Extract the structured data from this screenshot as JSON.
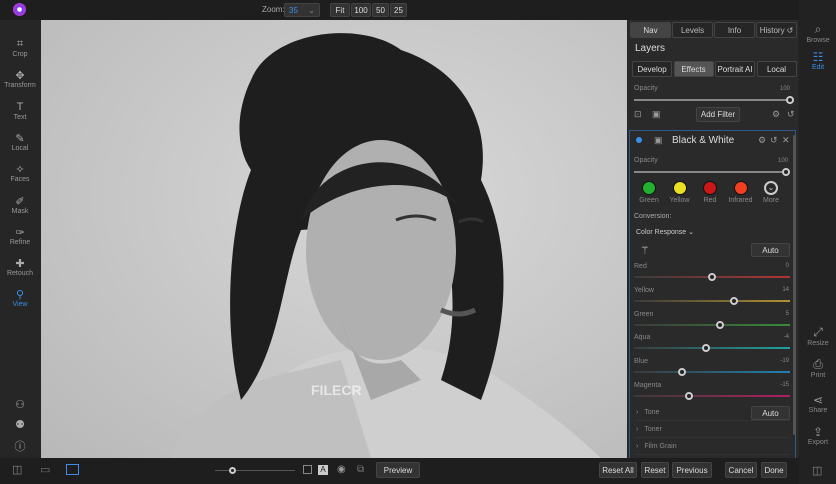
{
  "topbar": {
    "zoom_label": "Zoom:",
    "zoom_value": "35",
    "zoom_presets": [
      "Fit",
      "100",
      "50",
      "25"
    ]
  },
  "tools": [
    {
      "label": "Crop",
      "icon": "crop-icon",
      "g": "⌗"
    },
    {
      "label": "Transform",
      "icon": "transform-icon",
      "g": "✥"
    },
    {
      "label": "Text",
      "icon": "text-icon",
      "g": "T"
    },
    {
      "label": "Local",
      "icon": "brush-icon",
      "g": "✎"
    },
    {
      "label": "Faces",
      "icon": "faces-icon",
      "g": "✧"
    },
    {
      "label": "Mask",
      "icon": "mask-icon",
      "g": "✐"
    },
    {
      "label": "Refine",
      "icon": "refine-icon",
      "g": "✑"
    },
    {
      "label": "Retouch",
      "icon": "retouch-icon",
      "g": "✚"
    },
    {
      "label": "View",
      "icon": "view-icon",
      "g": "⚲"
    }
  ],
  "panel": {
    "tabs": [
      "Nav",
      "Levels",
      "Info",
      "History"
    ],
    "layers_title": "Layers",
    "subtabs": [
      "Develop",
      "Effects",
      "Portrait AI",
      "Local"
    ],
    "opacity_label": "Opacity",
    "opacity_value": "100",
    "opacity_fraction": 1.0,
    "add_filter": "Add Filter",
    "filter": {
      "title": "Black & White",
      "opacity_label": "Opacity",
      "opacity_value": "100",
      "presets": [
        {
          "label": "Green",
          "color": "#22b030"
        },
        {
          "label": "Yellow",
          "color": "#e8e020"
        },
        {
          "label": "Red",
          "color": "#c81818"
        },
        {
          "label": "Infrared",
          "color": "#f04020"
        },
        {
          "label": "More",
          "color": ""
        }
      ],
      "conversion_label": "Conversion:",
      "mode": "Color Response",
      "auto": "Auto",
      "sliders": [
        {
          "label": "Red",
          "value": 0,
          "color": "#b03535"
        },
        {
          "label": "Yellow",
          "value": 14,
          "color": "#b09030"
        },
        {
          "label": "Green",
          "value": 5,
          "color": "#3a8a3a"
        },
        {
          "label": "Aqua",
          "value": -4,
          "color": "#20a0a0"
        },
        {
          "label": "Blue",
          "value": -19,
          "color": "#2080b0"
        },
        {
          "label": "Magenta",
          "value": -15,
          "color": "#b02060"
        }
      ],
      "slider_range": [
        -50,
        50
      ],
      "sections": [
        "Tone",
        "Toner",
        "Film Grain"
      ],
      "tone_auto": "Auto"
    }
  },
  "right_strip": [
    {
      "label": "Browse",
      "g": "⌕"
    },
    {
      "label": "Edit",
      "g": "☷"
    },
    {
      "label": "Resize",
      "g": "⤢"
    },
    {
      "label": "Print",
      "g": "⎙"
    },
    {
      "label": "Share",
      "g": "⋖"
    },
    {
      "label": "Export",
      "g": "⇪"
    }
  ],
  "bottom": {
    "preview": "Preview",
    "buttons": [
      "Reset All",
      "Reset",
      "Previous"
    ],
    "cancel": "Cancel",
    "done": "Done"
  },
  "watermark": "FILECR"
}
